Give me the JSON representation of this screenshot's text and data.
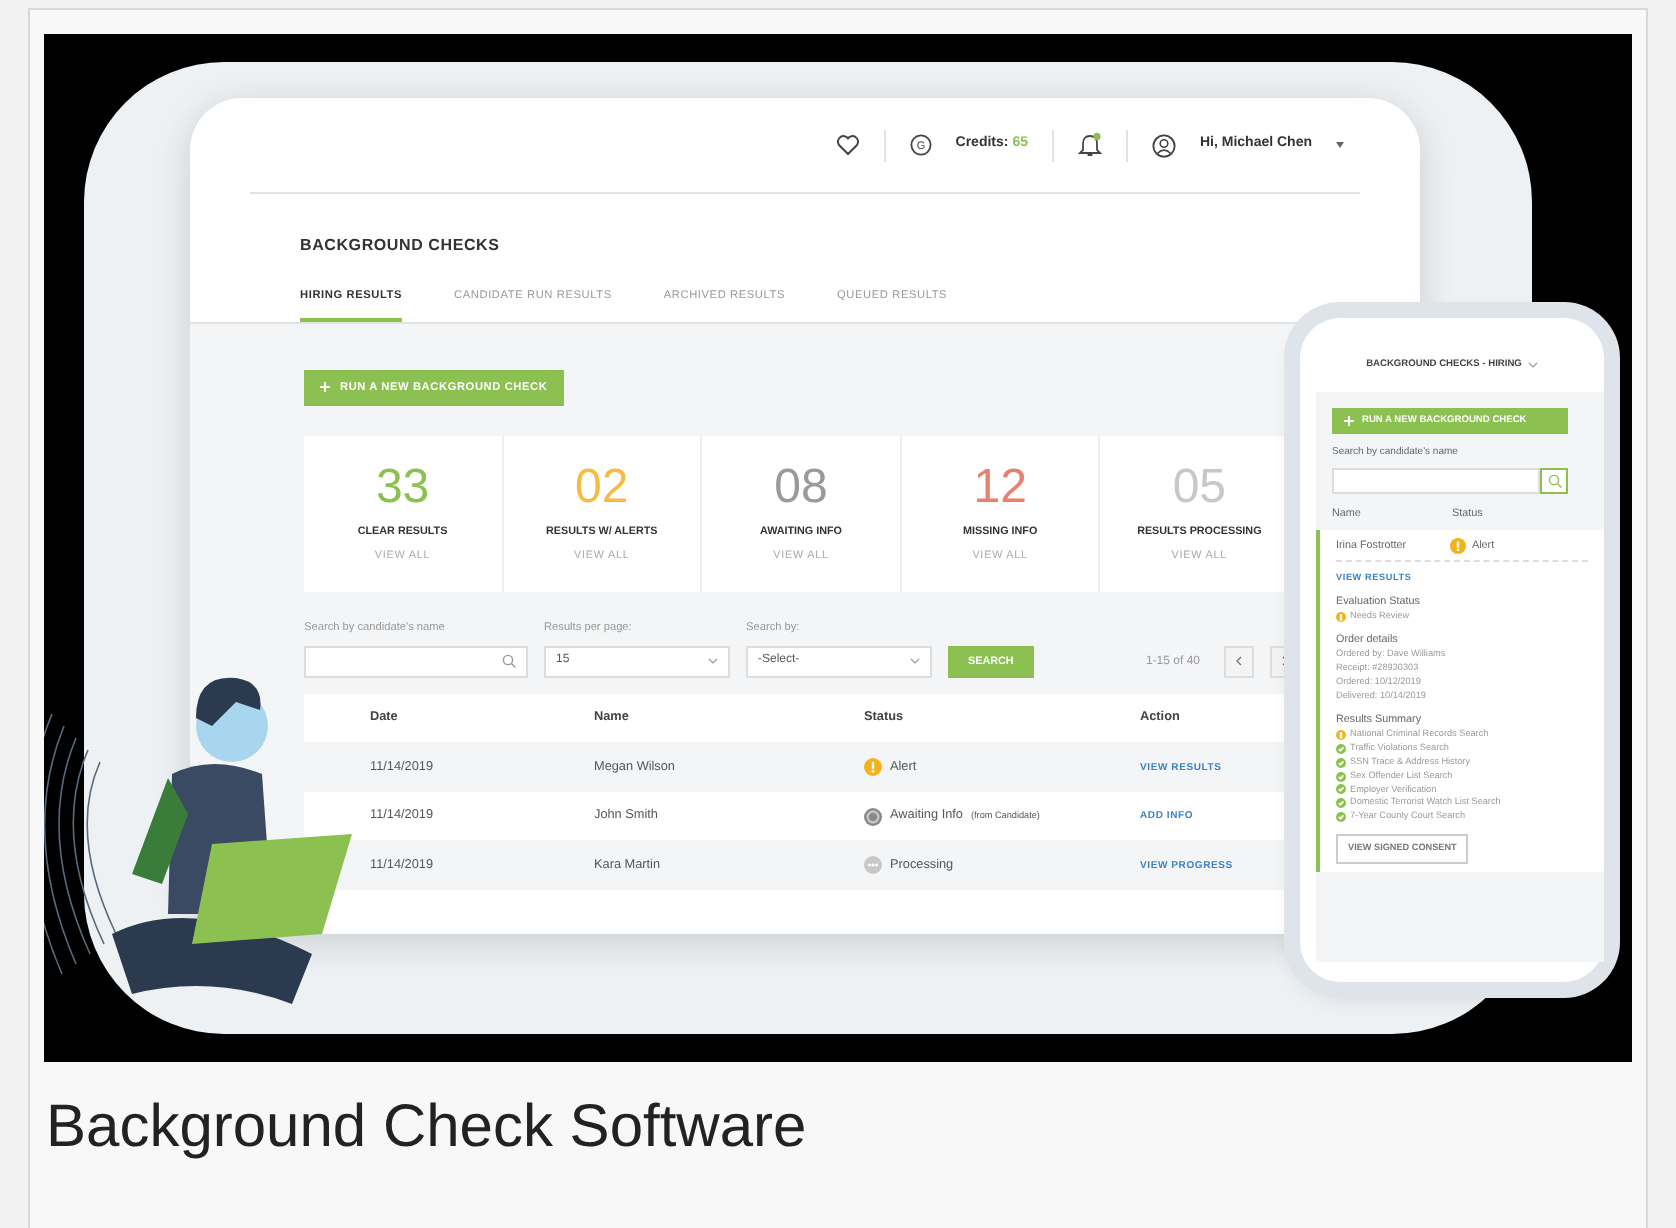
{
  "header": {
    "coin_symbol": "G",
    "credits_label": "Credits:",
    "credits_value": "65",
    "notification_dot": true,
    "user": "Hi, Michael Chen"
  },
  "page_title": "BACKGROUND CHECKS",
  "tabs": [
    {
      "label": "HIRING RESULTS",
      "selected": true
    },
    {
      "label": "CANDIDATE RUN RESULTS",
      "selected": false
    },
    {
      "label": "ARCHIVED RESULTS",
      "selected": false
    },
    {
      "label": "QUEUED RESULTS",
      "selected": false
    }
  ],
  "primary_button": "RUN A NEW BACKGROUND CHECK",
  "stats": [
    {
      "value": "33",
      "label": "CLEAR RESULTS",
      "link": "VIEW ALL",
      "color": "#8cc152"
    },
    {
      "value": "02",
      "label": "RESULTS  W/ ALERTS",
      "link": "VIEW ALL",
      "color": "#f6bb42"
    },
    {
      "value": "08",
      "label": "AWAITING INFO",
      "link": "VIEW ALL",
      "color": "#9a9a9a"
    },
    {
      "value": "12",
      "label": "MISSING INFO",
      "link": "VIEW ALL",
      "color": "#e9806e"
    },
    {
      "value": "05",
      "label": "RESULTS PROCESSING",
      "link": "VIEW ALL",
      "color": "#c8c8c8"
    }
  ],
  "filters": {
    "search_label": "Search by candidate's name",
    "per_page_label": "Results per page:",
    "per_page_value": "15",
    "search_by_label": "Search by:",
    "search_by_value": "-Select-",
    "search_button": "SEARCH",
    "range": "1-15 of 40"
  },
  "table": {
    "columns": [
      "Date",
      "Name",
      "Status",
      "Action"
    ],
    "rows": [
      {
        "date": "11/14/2019",
        "name": "Megan Wilson",
        "kind": "alert",
        "status": "Alert",
        "action": "VIEW RESULTS"
      },
      {
        "date": "11/14/2019",
        "name": "John Smith",
        "kind": "awaiting",
        "status": "Awaiting Info",
        "status_note": "(from Candidate)",
        "action": "ADD INFO"
      },
      {
        "date": "11/14/2019",
        "name": "Kara Martin",
        "kind": "processing",
        "status": "Processing",
        "action": "VIEW PROGRESS"
      }
    ]
  },
  "mobile": {
    "title": "BACKGROUND CHECKS - HIRING",
    "button": "RUN A NEW BACKGROUND CHECK",
    "search_label": "Search by candidate's name",
    "columns": [
      "Name",
      "Status"
    ],
    "row": {
      "name": "Irina Fostrotter",
      "kind": "alert",
      "status": "Alert",
      "link": "VIEW RESULTS"
    },
    "evaluation_title": "Evaluation Status",
    "evaluation": {
      "kind": "alert",
      "status": "Needs Review"
    },
    "order_title": "Order details",
    "order_lines": [
      "Ordered by: Dave Williams",
      "Receipt: #28930303",
      "Ordered: 10/12/2019",
      "Delivered: 10/14/2019"
    ],
    "summary_title": "Results Summary",
    "summary": [
      {
        "kind": "alert",
        "label": "National Criminal Records Search"
      },
      {
        "kind": "clear",
        "label": "Traffic Violations Search"
      },
      {
        "kind": "clear",
        "label": "SSN Trace & Address History"
      },
      {
        "kind": "clear",
        "label": "Sex Offender List Search"
      },
      {
        "kind": "clear",
        "label": "Employer Verification"
      },
      {
        "kind": "clear",
        "label": "Domestic Terrorist Watch List Search"
      },
      {
        "kind": "clear",
        "label": "7-Year County Court Search"
      }
    ],
    "consent_button": "VIEW SIGNED CONSENT"
  },
  "caption": "Background Check Software"
}
